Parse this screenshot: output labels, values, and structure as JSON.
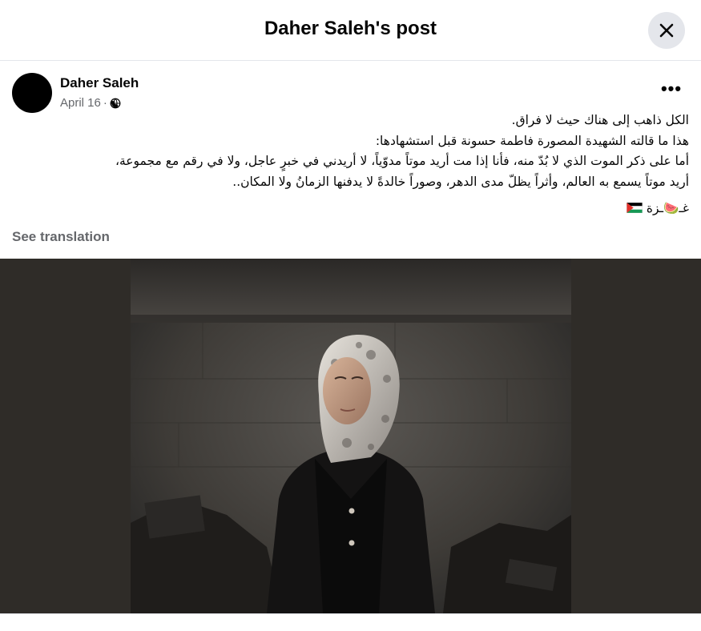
{
  "header": {
    "title": "Daher Saleh's post",
    "close_icon": "close-icon"
  },
  "post": {
    "author": "Daher Saleh",
    "date": "April 16",
    "separator": "·",
    "privacy_icon": "globe-icon",
    "more_label": "•••",
    "text_lines": [
      "الكل ذاهب إلى هناك حيث لا فراق.",
      "هذا ما قالته الشهيدة المصورة  فاطمة حسونة قبل استشهادها:",
      "أما على ذكر الموت الذي لا بُدّ منه، فأنا إذا مت أريد موتاً مدوّياً، لا أريدني في خبرٍ عاجل، ولا في رقم مع مجموعة،",
      "أريد موتاً يسمع به العالم، وأثراً يظلّ مدى الدهر، وصوراً خالدةً لا يدفنها الزمانُ ولا المكان.."
    ],
    "hashtag": "غـ🍉ـزة",
    "flag_icon": "palestine-flag-icon",
    "see_translation": "See translation"
  },
  "photo": {
    "description_icon": "photo-woman-in-hijab"
  },
  "colors": {
    "close_bg": "#e4e6eb",
    "muted_text": "#65676b",
    "photo_bg": "#2f2c28"
  }
}
